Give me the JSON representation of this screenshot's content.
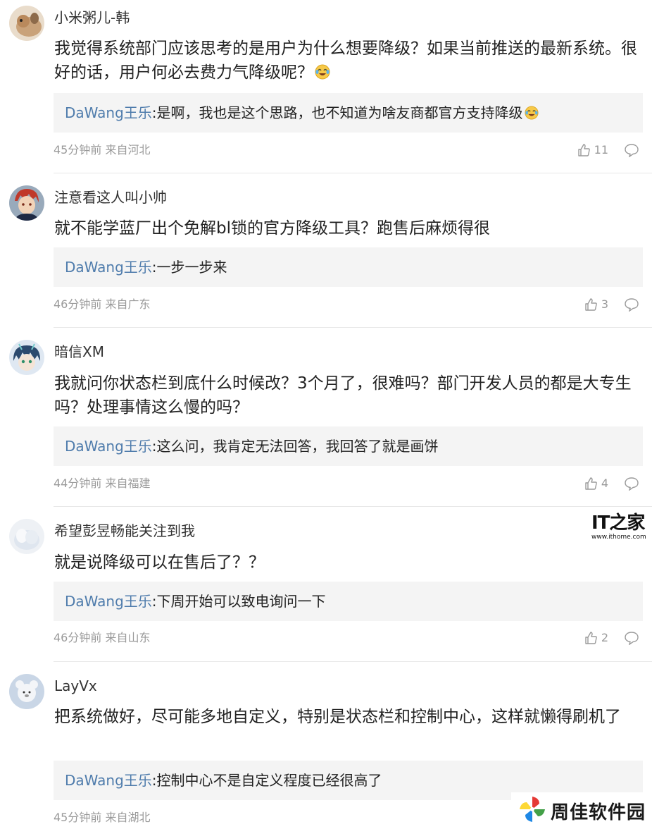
{
  "comments": [
    {
      "username": "小米粥儿-韩",
      "content": "我觉得系统部门应该思考的是用户为什么想要降级？如果当前推送的最新系统。很好的话，用户何必去费力气降级呢？",
      "reply_author": "DaWang王乐",
      "reply_text": ":是啊，我也是这个思路，也不知道为啥友商都官方支持降级",
      "meta": "45分钟前 来自河北",
      "likes": "11",
      "avatar_color": "#c9a27a"
    },
    {
      "username": "注意看这人叫小帅",
      "content": "就不能学蓝厂出个免解bl锁的官方降级工具？跑售后麻烦得很",
      "reply_author": "DaWang王乐",
      "reply_text": ":一步一步来",
      "meta": "46分钟前 来自广东",
      "likes": "3",
      "avatar_color": "#c0392b"
    },
    {
      "username": "暗信XM",
      "content": "我就问你状态栏到底什么时候改？3个月了，很难吗？部门开发人员的都是大专生吗？处理事情这么慢的吗？",
      "reply_author": "DaWang王乐",
      "reply_text": ":这么问，我肯定无法回答，我回答了就是画饼",
      "meta": "44分钟前 来自福建",
      "likes": "4",
      "avatar_color": "#3b5f8a"
    },
    {
      "username": "希望彭昱畅能关注到我",
      "content": "就是说降级可以在售后了？？",
      "reply_author": "DaWang王乐",
      "reply_text": ":下周开始可以致电询问一下",
      "meta": "46分钟前 来自山东",
      "likes": "2",
      "avatar_color": "#dfe6ef"
    },
    {
      "username": "LayVx",
      "content": "把系统做好，尽可能多地自定义，特别是状态栏和控制中心，这样就懒得刷机了",
      "reply_author": "DaWang王乐",
      "reply_text": ":控制中心不是自定义程度已经很高了",
      "meta": "45分钟前 来自湖北",
      "likes": "",
      "avatar_color": "#b8c8dc"
    }
  ],
  "ithome": {
    "logo": "IT之家",
    "url": "www.ithome.com"
  },
  "watermark": {
    "text": "周佳软件园"
  },
  "colors": {
    "author": "#4f7cac",
    "reply_bg": "#f4f4f4",
    "meta": "#9a9a9a"
  }
}
